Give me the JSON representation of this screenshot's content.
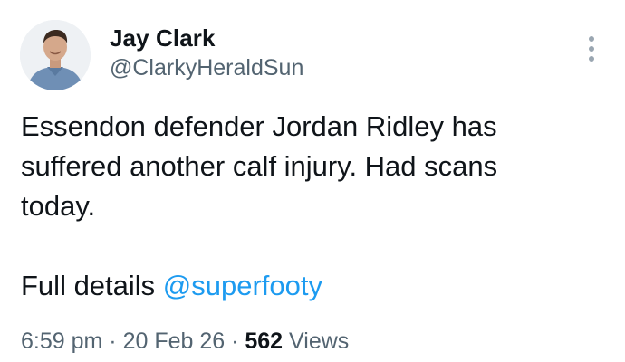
{
  "author": {
    "name": "Jay Clark",
    "handle": "@ClarkyHeraldSun",
    "avatar_icon": "profile-photo"
  },
  "more_icon": "vertical-ellipsis-icon",
  "tweet": {
    "line1": "Essendon defender Jordan Ridley has",
    "line2": "suffered another calf injury. Had scans",
    "line3": "today.",
    "details_prefix": "Full details ",
    "mention": "@superfooty"
  },
  "meta": {
    "time": "6:59 pm",
    "sep1": " · ",
    "date": "20 Feb 26",
    "sep2": " · ",
    "views_count": "562",
    "views_label": " Views"
  },
  "colors": {
    "link": "#1d9bf0",
    "secondary_text": "#536471",
    "primary_text": "#0f1419"
  }
}
